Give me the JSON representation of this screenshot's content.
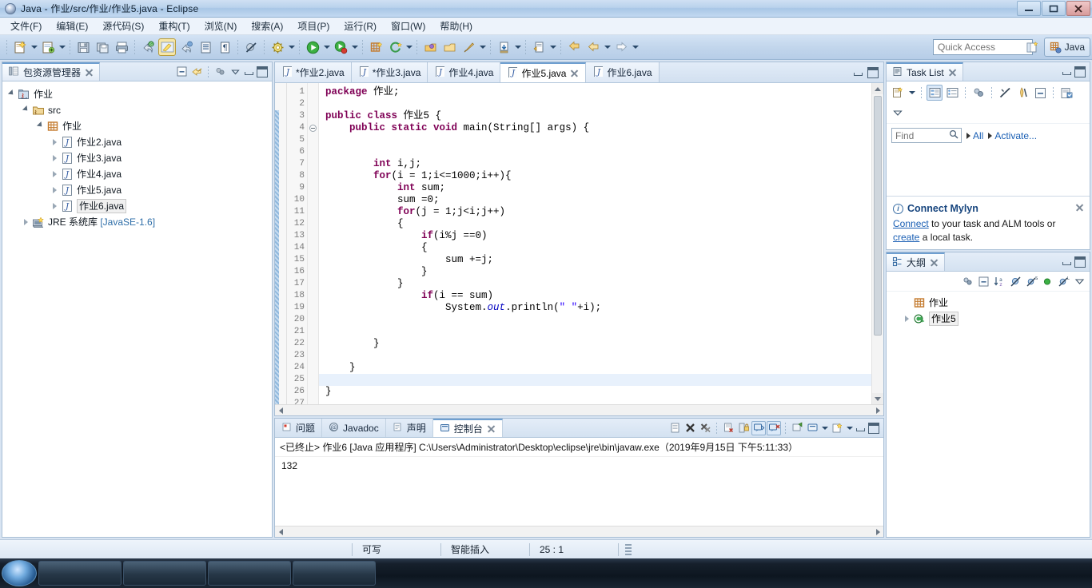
{
  "window": {
    "title": "Java - 作业/src/作业/作业5.java - Eclipse",
    "app_icon": "eclipse-icon",
    "minimize_label": "—",
    "maximize_label": "❐",
    "close_label": "✕"
  },
  "menubar": {
    "items": [
      {
        "label": "文件(F)",
        "name": "menu-file"
      },
      {
        "label": "编辑(E)",
        "name": "menu-edit"
      },
      {
        "label": "源代码(S)",
        "name": "menu-source"
      },
      {
        "label": "重构(T)",
        "name": "menu-refactor"
      },
      {
        "label": "浏览(N)",
        "name": "menu-navigate"
      },
      {
        "label": "搜索(A)",
        "name": "menu-search"
      },
      {
        "label": "项目(P)",
        "name": "menu-project"
      },
      {
        "label": "运行(R)",
        "name": "menu-run"
      },
      {
        "label": "窗口(W)",
        "name": "menu-window"
      },
      {
        "label": "帮助(H)",
        "name": "menu-help"
      }
    ]
  },
  "toolbar": {
    "quick_access_placeholder": "Quick Access",
    "perspective_label": "Java",
    "icons": [
      "new-wizard-icon",
      "new-java-class-icon",
      "save-icon",
      "save-all-icon",
      "print-icon",
      "undo-icon",
      "edit-highlight-icon",
      "refresh-icon",
      "open-type-icon",
      "toggle-markoccurrences-icon",
      "skip-breakpoints-icon",
      "debug-config-icon",
      "run-icon",
      "run-last-icon",
      "new-java-project-icon",
      "new-annotation-icon",
      "open-type-hierarchy-icon",
      "open-task-icon",
      "external-tools-icon",
      "search-icon",
      "next-annotation-icon",
      "previous-annotation-icon",
      "back-icon",
      "forward-icon"
    ]
  },
  "package_explorer": {
    "tab_label": "包资源管理器",
    "tab_icon": "package-explorer-icon",
    "tools": [
      "collapse-all-icon",
      "link-with-editor-icon",
      "view-menu-icon",
      "minimize-icon",
      "maximize-icon"
    ],
    "tree": [
      {
        "label": "作业",
        "icon": "java-project-icon",
        "indent": 0,
        "state": "open",
        "selected": false
      },
      {
        "label": "src",
        "icon": "source-folder-icon",
        "indent": 1,
        "state": "open",
        "selected": false
      },
      {
        "label": "作业",
        "icon": "package-icon",
        "indent": 2,
        "state": "open",
        "selected": false
      },
      {
        "label": "作业2.java",
        "icon": "java-file-icon",
        "indent": 3,
        "state": "closed",
        "selected": false
      },
      {
        "label": "作业3.java",
        "icon": "java-file-icon",
        "indent": 3,
        "state": "closed",
        "selected": false
      },
      {
        "label": "作业4.java",
        "icon": "java-file-icon",
        "indent": 3,
        "state": "closed",
        "selected": false
      },
      {
        "label": "作业5.java",
        "icon": "java-file-icon",
        "indent": 3,
        "state": "closed",
        "selected": false
      },
      {
        "label": "作业6.java",
        "icon": "java-file-icon",
        "indent": 3,
        "state": "closed",
        "selected": true
      },
      {
        "label": "JRE 系统库 ",
        "suffix": "[JavaSE-1.6]",
        "icon": "library-icon",
        "indent": 1,
        "state": "closed",
        "selected": false
      }
    ]
  },
  "editor": {
    "tabs": [
      {
        "label": "*作业2.java",
        "active": false,
        "dirty": true
      },
      {
        "label": "*作业3.java",
        "active": false,
        "dirty": true
      },
      {
        "label": "作业4.java",
        "active": false,
        "dirty": false
      },
      {
        "label": "作业5.java",
        "active": true,
        "dirty": false
      },
      {
        "label": "作业6.java",
        "active": false,
        "dirty": false
      }
    ],
    "tools": [
      "minimize-icon",
      "maximize-icon"
    ],
    "total_lines": 27,
    "current_line": 25,
    "changed_lines": [
      3,
      27
    ],
    "fold_line": 4,
    "lines": [
      {
        "n": 1,
        "tokens": [
          {
            "t": "package ",
            "c": "kw"
          },
          {
            "t": "作业;",
            "c": ""
          }
        ]
      },
      {
        "n": 2,
        "tokens": []
      },
      {
        "n": 3,
        "tokens": [
          {
            "t": "public class ",
            "c": "kw"
          },
          {
            "t": "作业5 {",
            "c": ""
          }
        ]
      },
      {
        "n": 4,
        "tokens": [
          {
            "t": "    ",
            "c": ""
          },
          {
            "t": "public static void ",
            "c": "kw"
          },
          {
            "t": "main(String[] args) {",
            "c": ""
          }
        ]
      },
      {
        "n": 5,
        "tokens": []
      },
      {
        "n": 6,
        "tokens": []
      },
      {
        "n": 7,
        "tokens": [
          {
            "t": "        ",
            "c": ""
          },
          {
            "t": "int ",
            "c": "kw"
          },
          {
            "t": "i,j;",
            "c": ""
          }
        ]
      },
      {
        "n": 8,
        "tokens": [
          {
            "t": "        ",
            "c": ""
          },
          {
            "t": "for",
            "c": "kw"
          },
          {
            "t": "(i = 1;i<=1000;i++){",
            "c": ""
          }
        ]
      },
      {
        "n": 9,
        "tokens": [
          {
            "t": "            ",
            "c": ""
          },
          {
            "t": "int ",
            "c": "kw"
          },
          {
            "t": "sum;",
            "c": ""
          }
        ]
      },
      {
        "n": 10,
        "tokens": [
          {
            "t": "            sum =0;",
            "c": ""
          }
        ]
      },
      {
        "n": 11,
        "tokens": [
          {
            "t": "            ",
            "c": ""
          },
          {
            "t": "for",
            "c": "kw"
          },
          {
            "t": "(j = 1;j<i;j++)",
            "c": ""
          }
        ]
      },
      {
        "n": 12,
        "tokens": [
          {
            "t": "            {",
            "c": ""
          }
        ]
      },
      {
        "n": 13,
        "tokens": [
          {
            "t": "                ",
            "c": ""
          },
          {
            "t": "if",
            "c": "kw"
          },
          {
            "t": "(i%j ==0)",
            "c": ""
          }
        ]
      },
      {
        "n": 14,
        "tokens": [
          {
            "t": "                {",
            "c": ""
          }
        ]
      },
      {
        "n": 15,
        "tokens": [
          {
            "t": "                    sum +=j;",
            "c": ""
          }
        ]
      },
      {
        "n": 16,
        "tokens": [
          {
            "t": "                }",
            "c": ""
          }
        ]
      },
      {
        "n": 17,
        "tokens": [
          {
            "t": "            }",
            "c": ""
          }
        ]
      },
      {
        "n": 18,
        "tokens": [
          {
            "t": "                ",
            "c": ""
          },
          {
            "t": "if",
            "c": "kw"
          },
          {
            "t": "(i == sum)",
            "c": ""
          }
        ]
      },
      {
        "n": 19,
        "tokens": [
          {
            "t": "                    System.",
            "c": ""
          },
          {
            "t": "out",
            "c": "fld"
          },
          {
            "t": ".println(",
            "c": ""
          },
          {
            "t": "\" \"",
            "c": "str"
          },
          {
            "t": "+i);",
            "c": ""
          }
        ]
      },
      {
        "n": 20,
        "tokens": []
      },
      {
        "n": 21,
        "tokens": []
      },
      {
        "n": 22,
        "tokens": [
          {
            "t": "        }",
            "c": ""
          }
        ]
      },
      {
        "n": 23,
        "tokens": []
      },
      {
        "n": 24,
        "tokens": [
          {
            "t": "    }",
            "c": ""
          }
        ]
      },
      {
        "n": 25,
        "tokens": []
      },
      {
        "n": 26,
        "tokens": [
          {
            "t": "}",
            "c": ""
          }
        ]
      },
      {
        "n": 27,
        "tokens": []
      }
    ]
  },
  "console": {
    "tabs": [
      {
        "label": "问题",
        "icon": "problems-icon",
        "active": false
      },
      {
        "label": "Javadoc",
        "icon": "javadoc-icon",
        "active": false
      },
      {
        "label": "声明",
        "icon": "declaration-icon",
        "active": false
      },
      {
        "label": "控制台",
        "icon": "console-icon",
        "active": true
      }
    ],
    "tools": [
      "clear-console-icon",
      "terminate-icon",
      "remove-all-terminated-icon",
      "remove-launch-icon",
      "lock-scroll-icon",
      "show-console-on-output-icon",
      "show-console-on-error-icon",
      "pin-console-icon",
      "display-selected-console-icon",
      "open-console-icon",
      "minimize-icon",
      "maximize-icon"
    ],
    "header": "<已终止> 作业6 [Java 应用程序] C:\\Users\\Administrator\\Desktop\\eclipse\\jre\\bin\\javaw.exe（2019年9月15日 下午5:11:33）",
    "output": "132"
  },
  "task_list": {
    "tab_label": "Task List",
    "tab_icon": "task-list-icon",
    "tools": [
      "new-task-icon",
      "dropdown-icon",
      "categorized-mode-icon",
      "scheduled-mode-icon",
      "synchronize-icon",
      "focus-on-workweek-icon",
      "filter-completed-icon",
      "collapse-all-icon",
      "view-menu-icon",
      "more-icon",
      "minimize-icon",
      "maximize-icon"
    ],
    "find_placeholder": "Find",
    "find_icon": "search-icon",
    "all_label": "All",
    "activate_label": "Activate...",
    "notice": {
      "title": "Connect Mylyn",
      "icon": "info-icon",
      "text_before": "",
      "link1": "Connect",
      "text_mid": " to your task and ALM tools or ",
      "link2": "create",
      "text_after": " a local task.",
      "close_icon": "close-icon"
    }
  },
  "outline": {
    "tab_label": "大纲",
    "tab_icon": "outline-icon",
    "tools": [
      "sync-icon",
      "collapse-all-icon",
      "sort-icon",
      "hide-fields-icon",
      "hide-static-icon",
      "hide-nonpublic-icon",
      "hide-local-types-icon",
      "view-menu-icon",
      "minimize-icon",
      "maximize-icon"
    ],
    "items": [
      {
        "label": "作业",
        "icon": "package-icon",
        "indent": 1,
        "state": "none",
        "selected": false
      },
      {
        "label": "作业5",
        "icon": "class-icon",
        "indent": 1,
        "state": "closed",
        "selected": true
      }
    ]
  },
  "statusbar": {
    "writable": "可写",
    "insert_mode": "智能插入",
    "cursor_position": "25 : 1"
  },
  "colors": {
    "accent": "#6f9fd0",
    "keyword": "#7f0055",
    "string": "#2a00ff",
    "field": "#0000c0",
    "link": "#1a5fb4",
    "titlebar": "#b9d2ec"
  }
}
